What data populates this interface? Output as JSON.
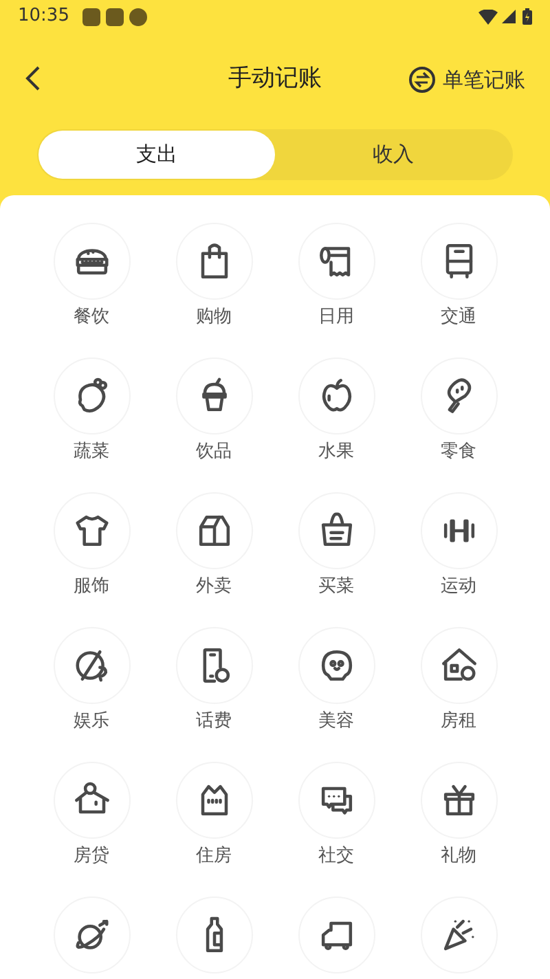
{
  "status_bar": {
    "time": "10:35"
  },
  "header": {
    "title": "手动记账",
    "action": "单笔记账"
  },
  "tabs": [
    {
      "label": "支出",
      "selected": true
    },
    {
      "label": "收入",
      "selected": false
    }
  ],
  "categories": [
    {
      "kind": "labeled",
      "label": "餐饮"
    },
    {
      "kind": "labeled",
      "label": "购物"
    },
    {
      "kind": "labeled",
      "label": "日用"
    },
    {
      "kind": "labeled",
      "label": "交通"
    },
    {
      "kind": "labeled",
      "label": "蔬菜"
    },
    {
      "kind": "labeled",
      "label": "饮品"
    },
    {
      "kind": "labeled",
      "label": "水果"
    },
    {
      "kind": "labeled",
      "label": "零食"
    },
    {
      "kind": "labeled",
      "label": "服饰"
    },
    {
      "kind": "labeled",
      "label": "外卖"
    },
    {
      "kind": "labeled",
      "label": "买菜"
    },
    {
      "kind": "labeled",
      "label": "运动"
    },
    {
      "kind": "labeled",
      "label": "娱乐"
    },
    {
      "kind": "labeled",
      "label": "话费"
    },
    {
      "kind": "labeled",
      "label": "美容"
    },
    {
      "kind": "labeled",
      "label": "房租"
    },
    {
      "kind": "labeled",
      "label": "房贷"
    },
    {
      "kind": "labeled",
      "label": "住房"
    },
    {
      "kind": "labeled",
      "label": "社交"
    },
    {
      "kind": "labeled",
      "label": "礼物"
    },
    {
      "kind": "icon_only"
    },
    {
      "kind": "icon_only"
    },
    {
      "kind": "icon_only"
    },
    {
      "kind": "icon_only"
    }
  ]
}
